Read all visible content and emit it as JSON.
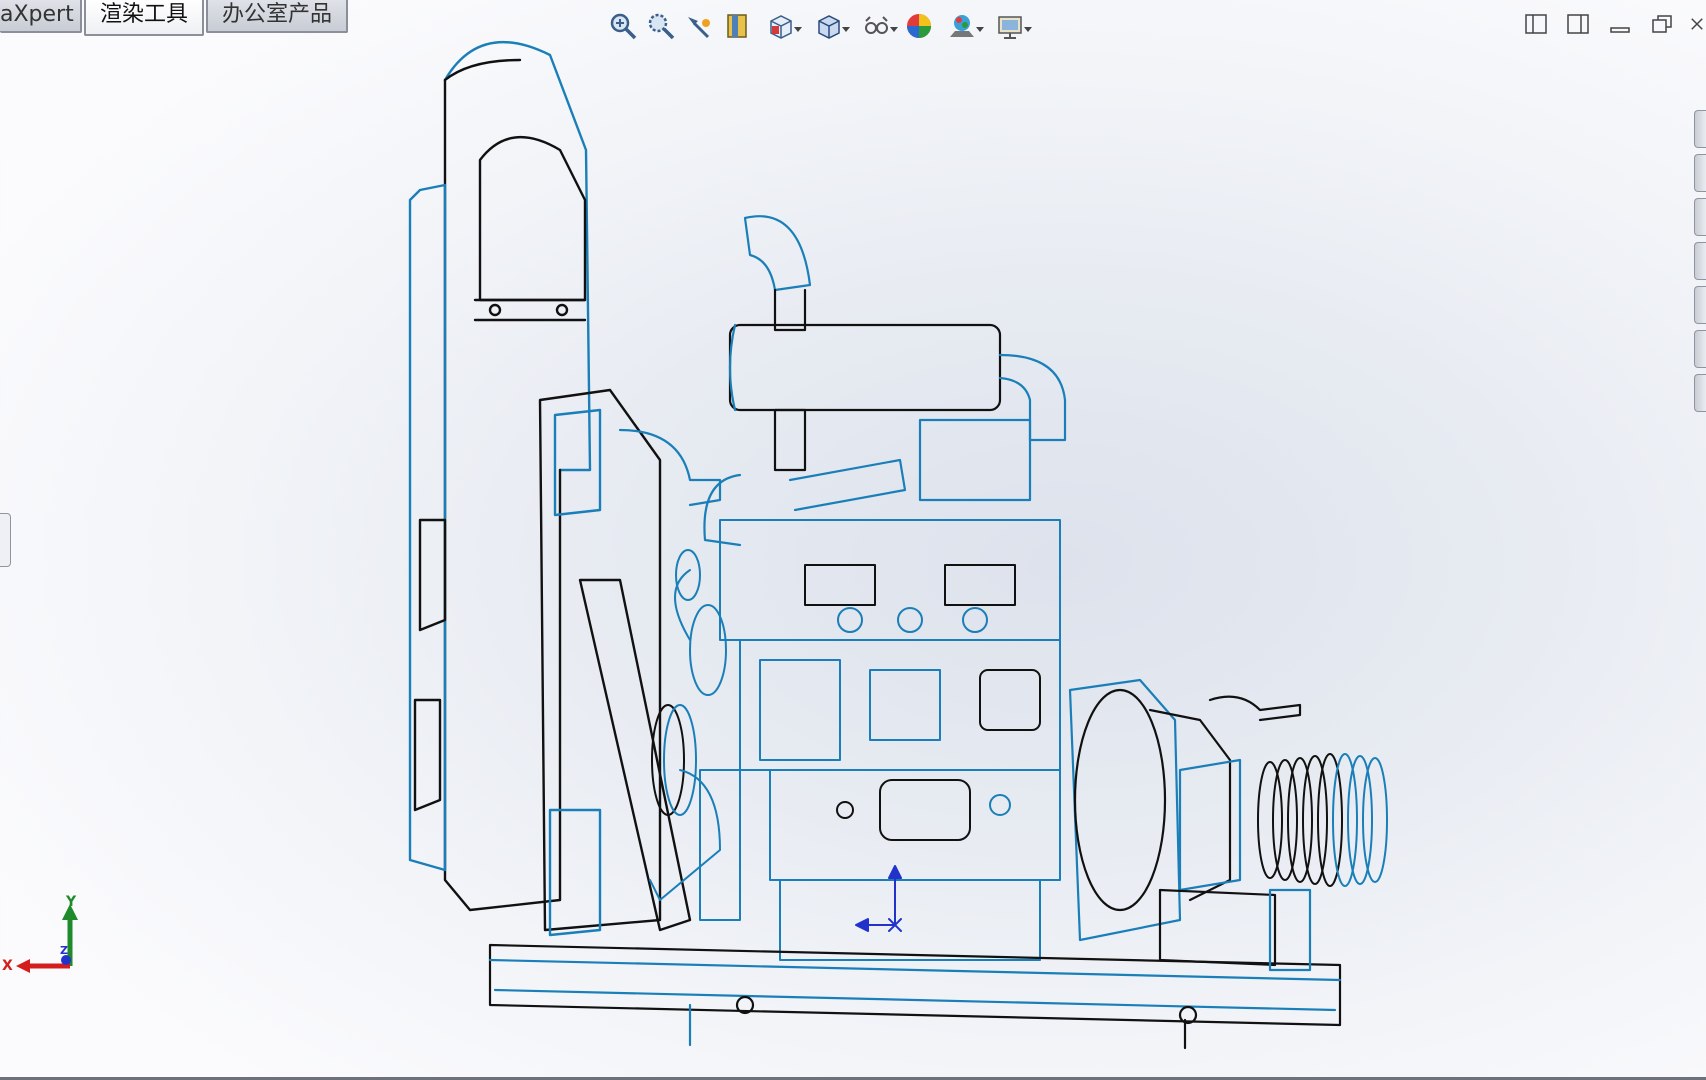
{
  "tabs": [
    {
      "label": "aXpert",
      "active": false
    },
    {
      "label": "渲染工具",
      "active": true
    },
    {
      "label": "办公室产品",
      "active": false
    }
  ],
  "toolbar": {
    "items": [
      {
        "icon": "zoom-to-fit-icon"
      },
      {
        "icon": "zoom-to-area-icon"
      },
      {
        "icon": "previous-view-icon"
      },
      {
        "icon": "section-view-icon"
      },
      {
        "icon": "view-orientation-icon",
        "dropdown": true
      },
      {
        "icon": "display-style-icon",
        "dropdown": true
      },
      {
        "icon": "hide-show-items-icon",
        "dropdown": true
      },
      {
        "icon": "edit-appearance-icon"
      },
      {
        "icon": "apply-scene-icon",
        "dropdown": true
      },
      {
        "icon": "view-settings-icon",
        "dropdown": true
      }
    ]
  },
  "window_controls": [
    "tile-left-icon",
    "tile-right-icon",
    "minimize-icon",
    "restore-icon",
    "close-icon"
  ],
  "triad": {
    "x_label": "X",
    "y_label": "Y",
    "z_label": "Z"
  },
  "colors": {
    "edge_blue": "#1a7fb8",
    "edge_black": "#111111",
    "axis_x": "#d41e1e",
    "axis_y": "#1e8a2a",
    "axis_z": "#2233cc"
  }
}
